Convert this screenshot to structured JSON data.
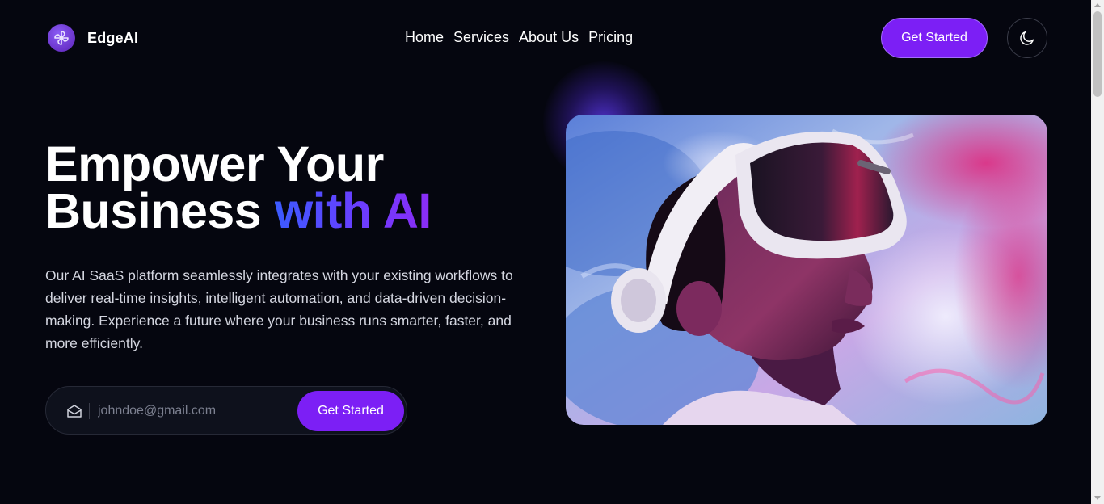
{
  "brand": {
    "name": "EdgeAI",
    "logo_icon": "pinwheel-logo-icon"
  },
  "nav": {
    "links": [
      {
        "label": "Home"
      },
      {
        "label": "Services"
      },
      {
        "label": "About Us"
      },
      {
        "label": "Pricing"
      }
    ],
    "cta_label": "Get Started",
    "theme_toggle_icon": "moon-icon"
  },
  "hero": {
    "headline_line1": "Empower Your",
    "headline_line2_plain": "Business",
    "headline_line2_accent": "with AI",
    "description": "Our AI SaaS platform seamlessly integrates with your existing workflows to deliver real-time insights, intelligent automation, and data-driven decision-making. Experience a future where your business runs smarter, faster, and more efficiently.",
    "email_placeholder": "johndoe@gmail.com",
    "email_value": "",
    "form_cta_label": "Get Started",
    "image_subject": "person wearing VR headset"
  },
  "colors": {
    "background": "#05060f",
    "primary": "#7c1ff5",
    "accent_gradient_start": "#3b5bff",
    "accent_gradient_end": "#8b2cf5"
  }
}
